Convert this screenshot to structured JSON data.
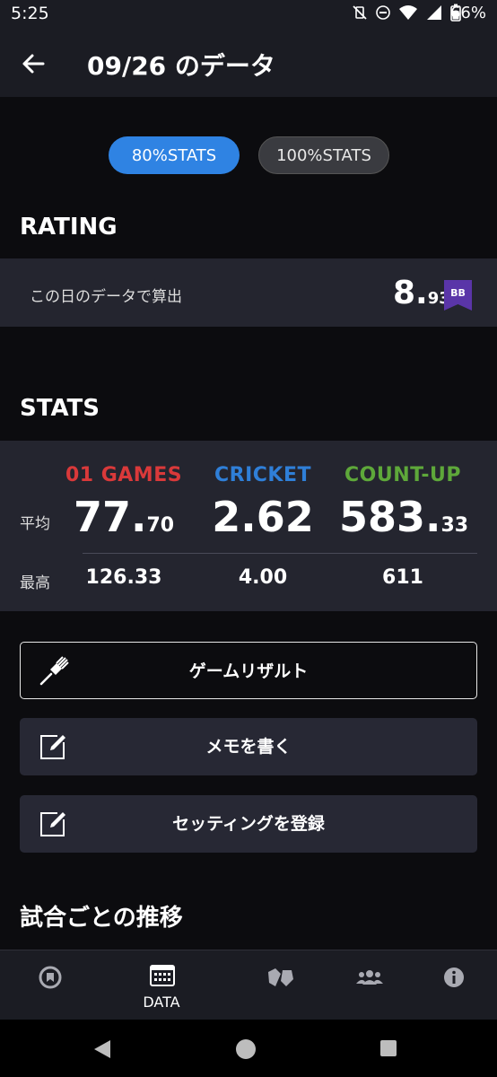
{
  "status_bar": {
    "time": "5:25",
    "battery": "66%"
  },
  "header": {
    "title": "09/26 のデータ"
  },
  "toggle": {
    "option_80": "80%STATS",
    "option_100": "100%STATS"
  },
  "rating": {
    "heading": "RATING",
    "label": "この日のデータで算出",
    "value_int": "8.",
    "value_dec": "93",
    "badge": "BB",
    "badge_color": "#5a35a8"
  },
  "stats": {
    "heading": "STATS",
    "row_avg_label": "平均",
    "row_max_label": "最高",
    "columns": [
      {
        "name": "01 GAMES",
        "color": "#d9393a",
        "avg_int": "77.",
        "avg_dec": "70",
        "max": "126.33"
      },
      {
        "name": "CRICKET",
        "color": "#2f7fd8",
        "avg_int": "2.62",
        "avg_dec": "",
        "max": "4.00"
      },
      {
        "name": "COUNT-UP",
        "color": "#5ea83a",
        "avg_int": "583.",
        "avg_dec": "33",
        "max": "611"
      }
    ]
  },
  "actions": {
    "game_result": "ゲームリザルト",
    "memo": "メモを書く",
    "setting": "セッティングを登録"
  },
  "trend": {
    "heading": "試合ごとの推移"
  },
  "bottom_nav": {
    "data_label": "DATA"
  }
}
